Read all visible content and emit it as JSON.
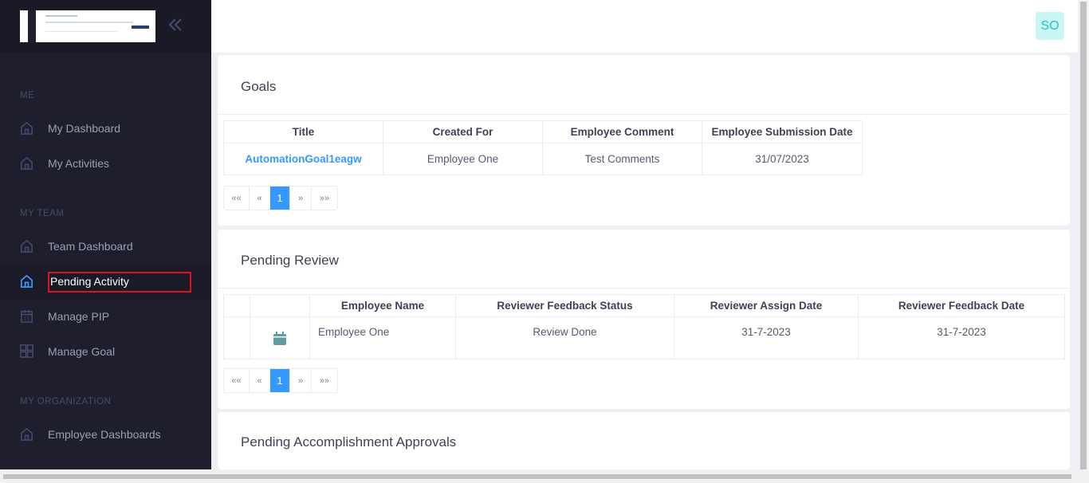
{
  "sidebar": {
    "collapse_icon": "double-chevron-left-icon",
    "sections": {
      "me": "ME",
      "my_team": "MY TEAM",
      "my_org": "MY ORGANIZATION"
    },
    "items": [
      {
        "label": "My Dashboard",
        "icon": "home-icon"
      },
      {
        "label": "My Activities",
        "icon": "home-icon"
      },
      {
        "label": "Team Dashboard",
        "icon": "home-icon"
      },
      {
        "label": "Pending Activity",
        "icon": "home-icon",
        "active": true
      },
      {
        "label": "Manage PIP",
        "icon": "calendar-icon"
      },
      {
        "label": "Manage Goal",
        "icon": "grid-icon"
      },
      {
        "label": "Employee Dashboards",
        "icon": "home-icon"
      }
    ]
  },
  "header": {
    "avatar_initials": "SO"
  },
  "goals": {
    "title": "Goals",
    "columns": [
      "Title",
      "Created For",
      "Employee Comment",
      "Employee Submission Date"
    ],
    "rows": [
      [
        "AutomationGoal1eagw",
        "Employee One",
        "Test Comments",
        "31/07/2023"
      ]
    ],
    "pager": {
      "first": "««",
      "prev": "«",
      "current": "1",
      "next": "»",
      "last": "»»"
    }
  },
  "pending_review": {
    "title": "Pending Review",
    "columns": [
      "",
      "",
      "Employee Name",
      "Reviewer Feedback Status",
      "Reviewer Assign Date",
      "Reviewer Feedback Date"
    ],
    "rows": [
      [
        "",
        "calendar-icon",
        "Employee One",
        "Review Done",
        "31-7-2023",
        "31-7-2023"
      ]
    ],
    "pager": {
      "first": "««",
      "prev": "«",
      "current": "1",
      "next": "»",
      "last": "»»"
    }
  },
  "accomplishments": {
    "title": "Pending Accomplishment Approvals"
  },
  "colors": {
    "sidebar_bg": "#1e1e2d",
    "accent": "#3699ff",
    "avatar_bg": "#c9f7f5",
    "avatar_fg": "#1bc5bd",
    "highlight_border": "#e0101e"
  }
}
